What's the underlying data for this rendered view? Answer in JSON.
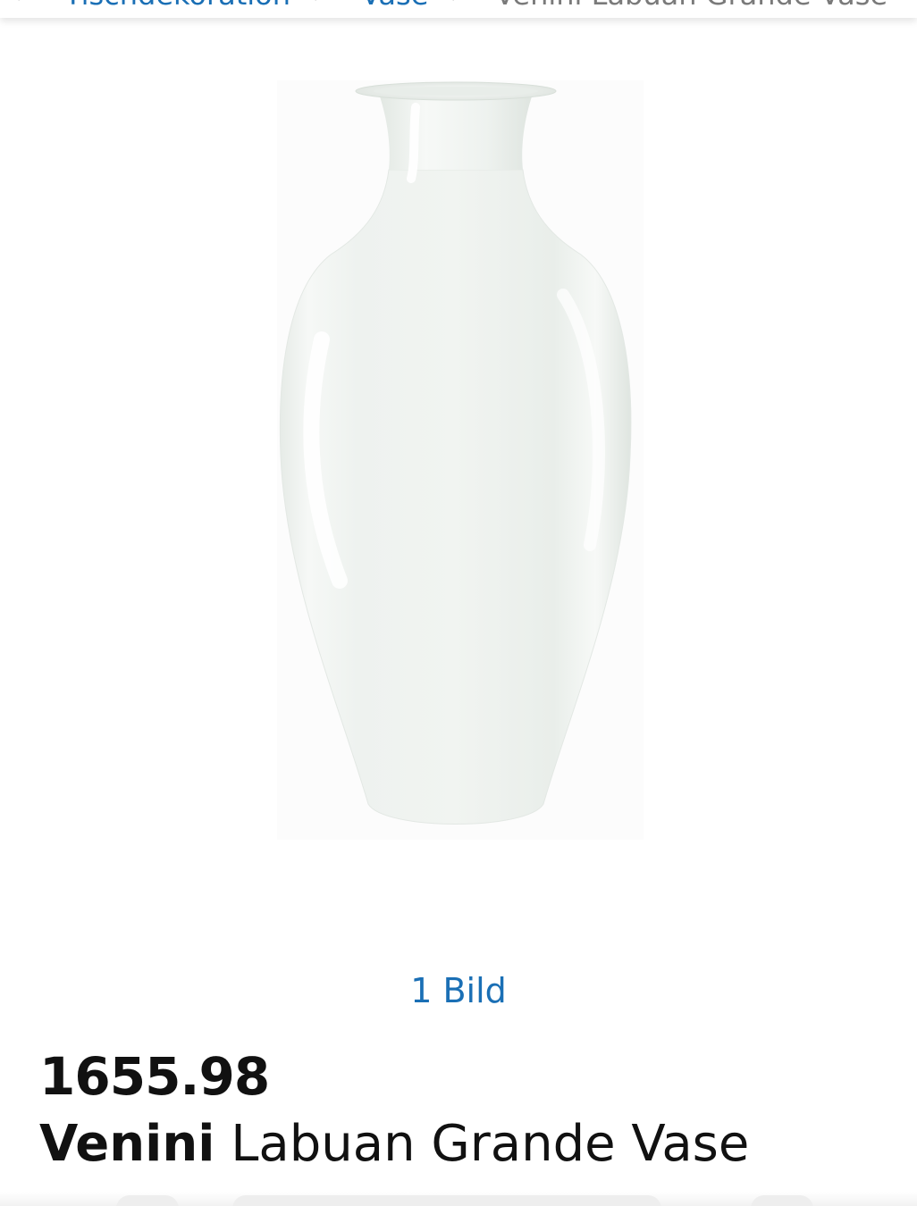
{
  "breadcrumb": {
    "items": [
      {
        "label": "Tischdekoration"
      },
      {
        "label": "Vase"
      }
    ],
    "current": "Venini Labuan Grande Vase",
    "separator": ">"
  },
  "gallery": {
    "image_alt": "Venini Labuan Grande Vase",
    "image_count_label": "1 Bild"
  },
  "product": {
    "price": "1655.98",
    "brand": "Venini",
    "name": "Labuan Grande Vase"
  },
  "colors": {
    "link": "#1a6fb5",
    "text": "#111111",
    "muted": "#7a7a7a"
  }
}
